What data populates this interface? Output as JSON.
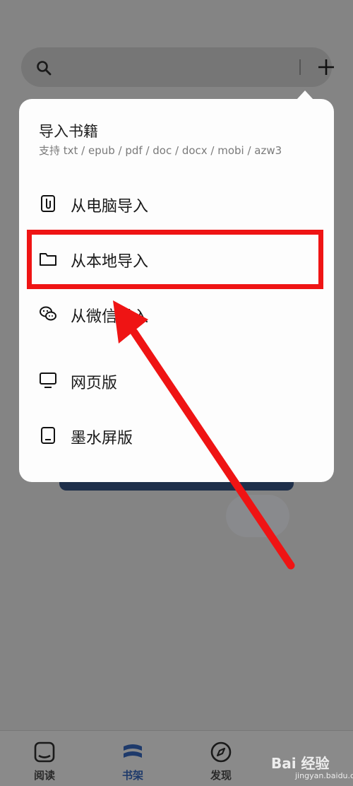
{
  "search": {
    "placeholder": ""
  },
  "popup": {
    "title": "导入书籍",
    "subtitle": "支持 txt / epub / pdf / doc / docx / mobi / azw3",
    "items": [
      {
        "label": "从电脑导入",
        "icon": "paperclip-icon"
      },
      {
        "label": "从本地导入",
        "icon": "folder-icon"
      },
      {
        "label": "从微信导入",
        "icon": "wechat-icon"
      },
      {
        "label": "网页版",
        "icon": "monitor-icon"
      },
      {
        "label": "墨水屏版",
        "icon": "tablet-icon"
      }
    ]
  },
  "tabbar": {
    "tabs": [
      {
        "label": "阅读",
        "icon": "reader-icon"
      },
      {
        "label": "书架",
        "icon": "bookshelf-icon",
        "active": true
      },
      {
        "label": "发现",
        "icon": "compass-icon"
      }
    ]
  },
  "watermark": {
    "text": "Bai 经验",
    "sub": "jingyan.baidu.com"
  },
  "colors": {
    "accent": "#1e3a6b",
    "highlight": "#ef1414"
  }
}
